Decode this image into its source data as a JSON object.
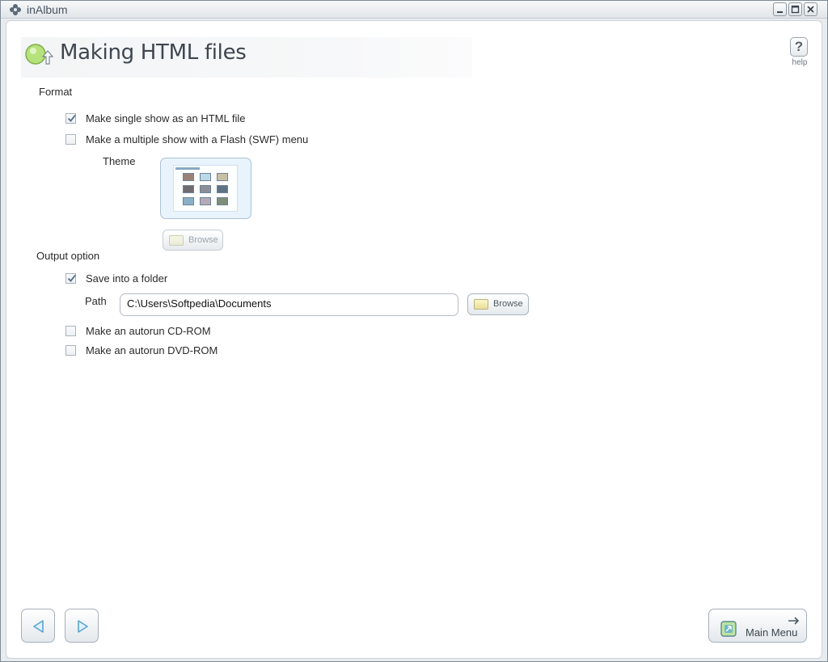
{
  "window": {
    "title": "inAlbum"
  },
  "header": {
    "title": "Making HTML files",
    "help_label": "help",
    "help_glyph": "?"
  },
  "format": {
    "label": "Format",
    "options": [
      {
        "label": "Make single show as an HTML file",
        "checked": true
      },
      {
        "label": "Make a multiple show with a Flash (SWF) menu",
        "checked": false
      }
    ],
    "theme_label": "Theme",
    "theme_browse_label": "Browse"
  },
  "output": {
    "label": "Output option",
    "save_folder": {
      "label": "Save into a folder",
      "checked": true
    },
    "path_label": "Path",
    "path_value": "C:\\Users\\Softpedia\\Documents",
    "browse_label": "Browse",
    "cd": {
      "label": "Make an autorun CD-ROM",
      "checked": false
    },
    "dvd": {
      "label": "Make an autorun DVD-ROM",
      "checked": false
    }
  },
  "footer": {
    "main_menu_label": "Main Menu"
  },
  "colors": {
    "accent": "#a6b0ba",
    "background": "#ffffff",
    "frame": "#e9ecef"
  }
}
